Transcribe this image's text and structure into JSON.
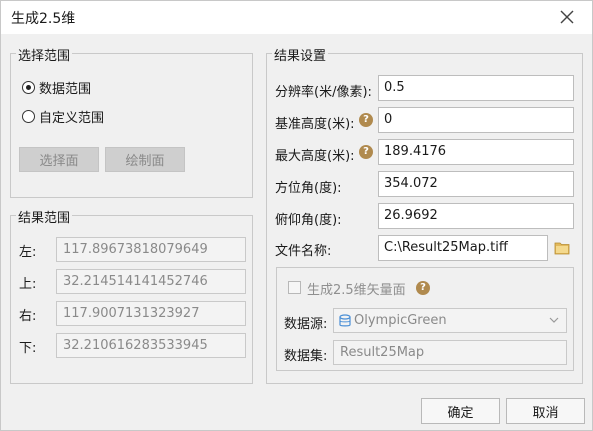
{
  "window": {
    "title": "生成2.5维"
  },
  "selection_range": {
    "legend": "选择范围",
    "radios": [
      {
        "label": "数据范围",
        "checked": true
      },
      {
        "label": "自定义范围",
        "checked": false
      }
    ],
    "buttons": {
      "select_face": "选择面",
      "draw_face": "绘制面"
    }
  },
  "result_range": {
    "legend": "结果范围",
    "rows": [
      {
        "label": "左:",
        "value": "117.89673818079649"
      },
      {
        "label": "上:",
        "value": "32.214514141452746"
      },
      {
        "label": "右:",
        "value": "117.9007131323927"
      },
      {
        "label": "下:",
        "value": "32.210616283533945"
      }
    ]
  },
  "result_settings": {
    "legend": "结果设置",
    "resolution": {
      "label": "分辨率(米/像素):",
      "value": "0.5"
    },
    "base_height": {
      "label": "基准高度(米):",
      "value": "0"
    },
    "max_height": {
      "label": "最大高度(米):",
      "value": "189.4176"
    },
    "azimuth": {
      "label": "方位角(度):",
      "value": "354.072"
    },
    "pitch": {
      "label": "俯仰角(度):",
      "value": "26.9692"
    },
    "file_name": {
      "label": "文件名称:",
      "value": "C:\\Result25Map.tiff"
    },
    "vector": {
      "checkbox_label": "生成2.5维矢量面",
      "checked": false,
      "datasource_label": "数据源:",
      "datasource_value": "OlympicGreen",
      "dataset_label": "数据集:",
      "dataset_value": "Result25Map"
    },
    "help_glyph": "?"
  },
  "footer": {
    "ok": "确定",
    "cancel": "取消"
  },
  "colors": {
    "help": "#b08a4e",
    "folder": "#e2b95c",
    "db_icon": "#4a8fd6"
  }
}
